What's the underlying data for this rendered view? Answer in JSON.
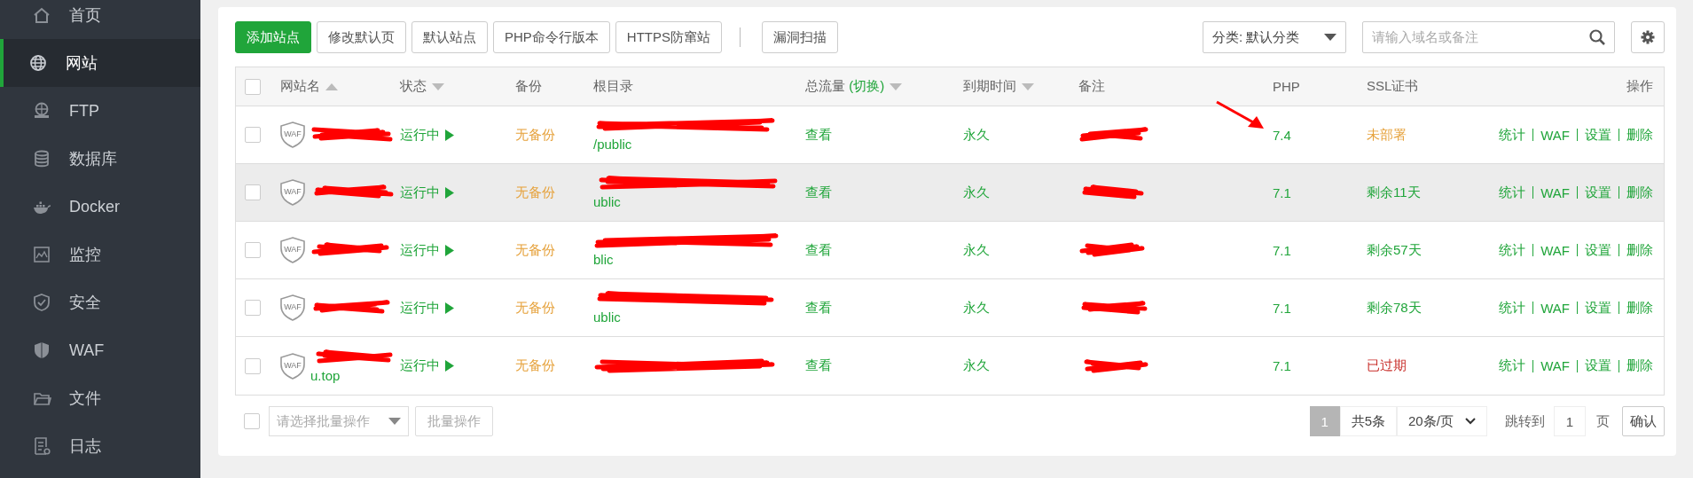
{
  "sidebar": {
    "items": [
      {
        "kind": "home",
        "label": "首页",
        "selected": false
      },
      {
        "kind": "globe",
        "label": "网站",
        "selected": true
      },
      {
        "kind": "ftp",
        "label": "FTP",
        "selected": false
      },
      {
        "kind": "database",
        "label": "数据库",
        "selected": false
      },
      {
        "kind": "docker",
        "label": "Docker",
        "selected": false
      },
      {
        "kind": "monitor",
        "label": "监控",
        "selected": false
      },
      {
        "kind": "shield",
        "label": "安全",
        "selected": false
      },
      {
        "kind": "waf",
        "label": "WAF",
        "selected": false
      },
      {
        "kind": "folder",
        "label": "文件",
        "selected": false
      },
      {
        "kind": "log",
        "label": "日志",
        "selected": false
      }
    ]
  },
  "toolbar": {
    "buttons": [
      {
        "label": "添加站点",
        "kind": "primary"
      },
      {
        "label": "修改默认页",
        "kind": "default"
      },
      {
        "label": "默认站点",
        "kind": "default"
      },
      {
        "label": "PHP命令行版本",
        "kind": "default"
      },
      {
        "label": "HTTPS防窜站",
        "kind": "default"
      }
    ],
    "scan_buttons": [
      {
        "label": "漏洞扫描",
        "kind": "default"
      }
    ],
    "category": "分类: 默认分类",
    "search": {
      "placeholder": "请输入域名或备注"
    }
  },
  "table": {
    "select_all": false,
    "columns": [
      {
        "label": "网站名",
        "sort_ascending": true
      },
      {
        "label": "状态",
        "sort_ascending": false
      },
      {
        "label": "备份"
      },
      {
        "label": "根目录"
      },
      {
        "label": "总流量",
        "toggle": "(切换)",
        "sort_ascending": false
      },
      {
        "label": "到期时间",
        "sort_ascending": false
      },
      {
        "label": "备注"
      },
      {
        "label": "PHP"
      },
      {
        "label": "SSL证书"
      },
      {
        "label": "操作"
      }
    ],
    "rows": [
      {
        "checked": false,
        "highlighted": false,
        "waf_badge": "WAF",
        "status": "运行中",
        "backup": "无备份",
        "root": "/public",
        "traffic": "查看",
        "expiry": "永久",
        "php": "7.4",
        "arrow": true,
        "ssl": {
          "text": "未部署",
          "kind": "pending"
        },
        "actions": [
          "统计",
          "WAF",
          "设置",
          "删除"
        ]
      },
      {
        "checked": false,
        "highlighted": true,
        "waf_badge": "WAF",
        "status": "运行中",
        "backup": "无备份",
        "root": "ublic",
        "traffic": "查看",
        "expiry": "永久",
        "php": "7.1",
        "ssl": {
          "text": "剩余11天",
          "kind": "valid"
        },
        "actions": [
          "统计",
          "WAF",
          "设置",
          "删除"
        ]
      },
      {
        "checked": false,
        "highlighted": false,
        "waf_badge": "WAF",
        "status": "运行中",
        "backup": "无备份",
        "root": "blic",
        "traffic": "查看",
        "expiry": "永久",
        "php": "7.1",
        "ssl": {
          "text": "剩余57天",
          "kind": "valid"
        },
        "actions": [
          "统计",
          "WAF",
          "设置",
          "删除"
        ]
      },
      {
        "checked": false,
        "highlighted": false,
        "waf_badge": "WAF",
        "status": "运行中",
        "backup": "无备份",
        "root": "ublic",
        "traffic": "查看",
        "expiry": "永久",
        "php": "7.1",
        "ssl": {
          "text": "剩余78天",
          "kind": "valid"
        },
        "actions": [
          "统计",
          "WAF",
          "设置",
          "删除"
        ]
      },
      {
        "checked": false,
        "highlighted": false,
        "waf_badge": "WAF",
        "name": "u.top",
        "status": "运行中",
        "backup": "无备份",
        "traffic": "查看",
        "expiry": "永久",
        "php": "7.1",
        "ssl": {
          "text": "已过期",
          "kind": "expired"
        },
        "actions": [
          "统计",
          "WAF",
          "设置",
          "删除"
        ]
      }
    ]
  },
  "footer": {
    "select_all": false,
    "batch_placeholder": "请选择批量操作",
    "batch_button": {
      "label": "批量操作",
      "disabled": true
    }
  },
  "pager": {
    "pages": [
      {
        "label": "1",
        "selected": true
      }
    ],
    "total": "共5条",
    "page_size": "20条/页",
    "jump_label": "跳转到",
    "jump_value": "1",
    "page_unit": "页",
    "confirm": "确认"
  }
}
